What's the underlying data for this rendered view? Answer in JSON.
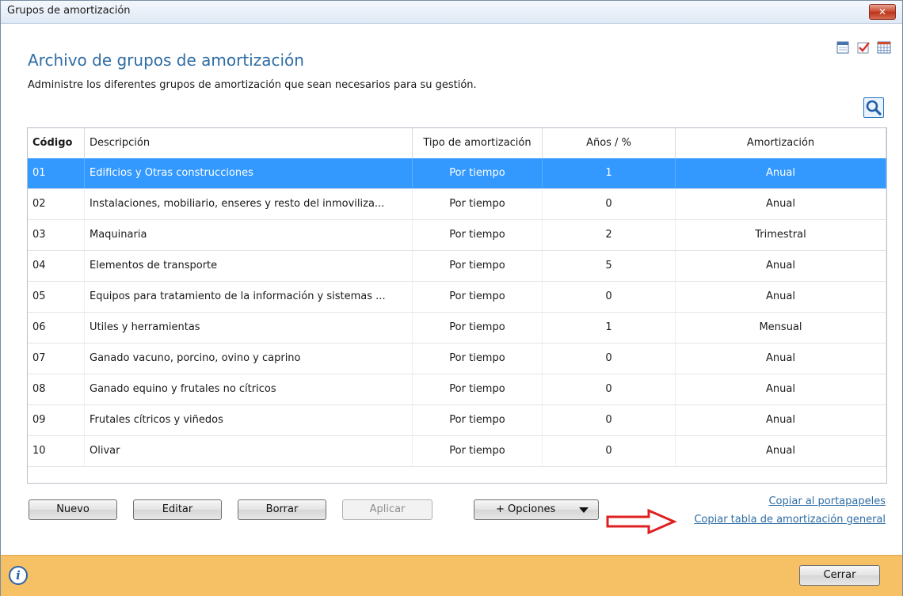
{
  "window": {
    "title": "Grupos de amortización",
    "close_label": "✕"
  },
  "header": {
    "title": "Archivo de grupos de amortización",
    "subtitle": "Administre los diferentes grupos de amortización que sean necesarios para su gestión."
  },
  "icons": [
    "calendar-icon",
    "checklist-icon",
    "grid-calendar-icon",
    "search-icon",
    "info-icon"
  ],
  "table": {
    "columns": [
      "Código",
      "Descripción",
      "Tipo de amortización",
      "Años / %",
      "Amortización"
    ],
    "rows": [
      {
        "codigo": "01",
        "descripcion": "Edificios y Otras construcciones",
        "tipo": "Por tiempo",
        "anios": "1",
        "amortizacion": "Anual"
      },
      {
        "codigo": "02",
        "descripcion": "Instalaciones, mobiliario, enseres y resto del inmoviliza...",
        "tipo": "Por tiempo",
        "anios": "0",
        "amortizacion": "Anual"
      },
      {
        "codigo": "03",
        "descripcion": "Maquinaria",
        "tipo": "Por tiempo",
        "anios": "2",
        "amortizacion": "Trimestral"
      },
      {
        "codigo": "04",
        "descripcion": "Elementos de transporte",
        "tipo": "Por tiempo",
        "anios": "5",
        "amortizacion": "Anual"
      },
      {
        "codigo": "05",
        "descripcion": "Equipos para tratamiento de la información y sistemas ...",
        "tipo": "Por tiempo",
        "anios": "0",
        "amortizacion": "Anual"
      },
      {
        "codigo": "06",
        "descripcion": "Utiles y herramientas",
        "tipo": "Por tiempo",
        "anios": "1",
        "amortizacion": "Mensual"
      },
      {
        "codigo": "07",
        "descripcion": "Ganado vacuno, porcino, ovino y caprino",
        "tipo": "Por tiempo",
        "anios": "0",
        "amortizacion": "Anual"
      },
      {
        "codigo": "08",
        "descripcion": "Ganado equino y frutales no cítricos",
        "tipo": "Por tiempo",
        "anios": "0",
        "amortizacion": "Anual"
      },
      {
        "codigo": "09",
        "descripcion": "Frutales cítricos y viñedos",
        "tipo": "Por tiempo",
        "anios": "0",
        "amortizacion": "Anual"
      },
      {
        "codigo": "10",
        "descripcion": "Olivar",
        "tipo": "Por tiempo",
        "anios": "0",
        "amortizacion": "Anual"
      }
    ]
  },
  "buttons": {
    "nuevo": "Nuevo",
    "editar": "Editar",
    "borrar": "Borrar",
    "aplicar": "Aplicar",
    "opciones": "+ Opciones",
    "cerrar": "Cerrar"
  },
  "links": {
    "copiar_portapapeles": "Copiar al portapapeles",
    "copiar_tabla": "Copiar tabla de amortización general"
  },
  "colors": {
    "selected_row": "#3399ff",
    "title_blue": "#2e6da4",
    "footer": "#f6c065",
    "annotation_arrow": "#e02020"
  }
}
